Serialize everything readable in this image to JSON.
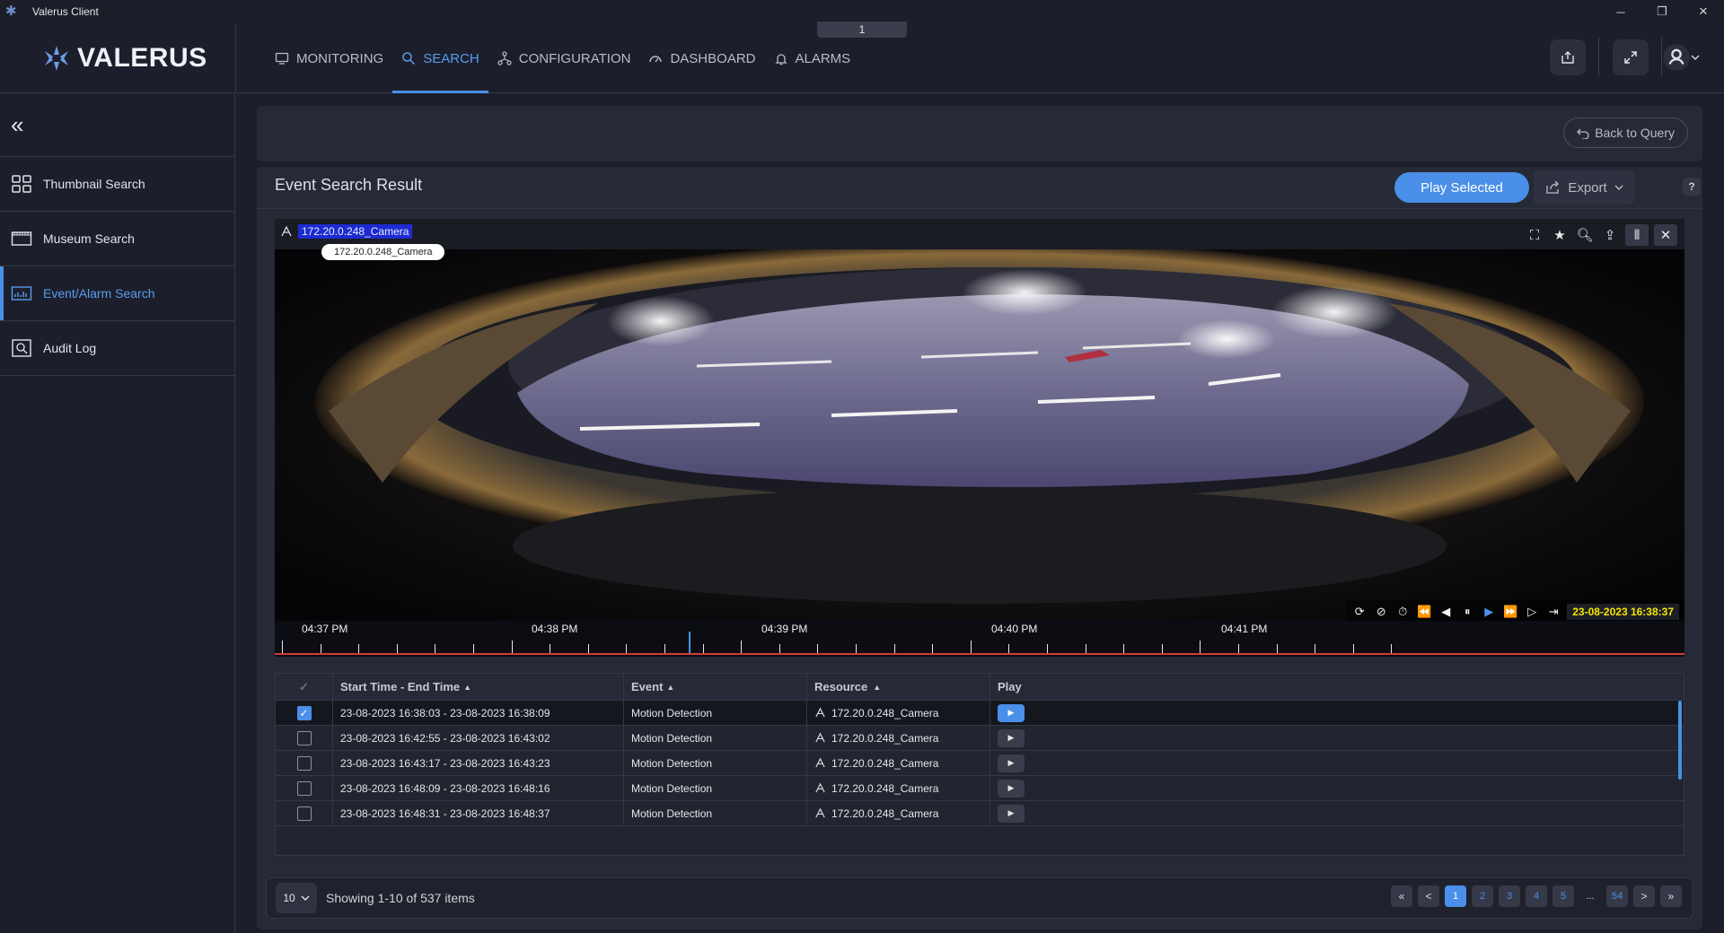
{
  "window": {
    "title": "Valerus Client",
    "page_tab": "1",
    "controls": {
      "minimize": "─",
      "restore": "❐",
      "close": "✕"
    }
  },
  "brand": {
    "name": "VALERUS"
  },
  "nav": [
    {
      "label": "MONITORING",
      "icon": "monitor-icon",
      "active": false
    },
    {
      "label": "SEARCH",
      "icon": "search-icon",
      "active": true
    },
    {
      "label": "CONFIGURATION",
      "icon": "configuration-icon",
      "active": false
    },
    {
      "label": "DASHBOARD",
      "icon": "dashboard-icon",
      "active": false
    },
    {
      "label": "ALARMS",
      "icon": "alarm-icon",
      "active": false
    }
  ],
  "sidebar": {
    "collapse_glyph": "«",
    "items": [
      {
        "label": "Thumbnail Search",
        "icon": "thumbnail-grid-icon",
        "active": false
      },
      {
        "label": "Museum Search",
        "icon": "museum-icon",
        "active": false
      },
      {
        "label": "Event/Alarm Search",
        "icon": "event-alarm-icon",
        "active": true
      },
      {
        "label": "Audit Log",
        "icon": "audit-log-icon",
        "active": false
      }
    ]
  },
  "query_bar": {
    "back_label": "Back to Query"
  },
  "result": {
    "title": "Event Search Result",
    "play_selected_label": "Play Selected",
    "help_label": "?",
    "export_label": "Export"
  },
  "video": {
    "camera_label": "172.20.0.248_Camera",
    "tooltip": "172.20.0.248_Camera",
    "timestamp": "23-08-2023 16:38:37",
    "timeline_labels": [
      "04:37 PM",
      "04:38 PM",
      "04:39 PM",
      "04:40 PM",
      "04:41 PM"
    ]
  },
  "table": {
    "headers": {
      "start_end": "Start Time - End Time",
      "event": "Event",
      "resource": "Resource",
      "play": "Play"
    },
    "rows": [
      {
        "time": "23-08-2023 16:38:03  - 23-08-2023 16:38:09",
        "event": "Motion Detection",
        "resource": "172.20.0.248_Camera",
        "checked": true
      },
      {
        "time": "23-08-2023 16:42:55  - 23-08-2023 16:43:02",
        "event": "Motion Detection",
        "resource": "172.20.0.248_Camera",
        "checked": false
      },
      {
        "time": "23-08-2023 16:43:17  - 23-08-2023 16:43:23",
        "event": "Motion Detection",
        "resource": "172.20.0.248_Camera",
        "checked": false
      },
      {
        "time": "23-08-2023 16:48:09  - 23-08-2023 16:48:16",
        "event": "Motion Detection",
        "resource": "172.20.0.248_Camera",
        "checked": false
      },
      {
        "time": "23-08-2023 16:48:31  - 23-08-2023 16:48:37",
        "event": "Motion Detection",
        "resource": "172.20.0.248_Camera",
        "checked": false
      }
    ]
  },
  "pager": {
    "page_size": "10",
    "showing": "Showing 1-10 of 537 items",
    "first": "«",
    "prev": "<",
    "next": ">",
    "last": "»",
    "pages": [
      "1",
      "2",
      "3",
      "4",
      "5"
    ],
    "ellipsis": "...",
    "last_page": "54",
    "current": "1"
  },
  "colors": {
    "accent": "#4a8fe8",
    "timestamp": "#f5e400",
    "timeline": "#d93a3a"
  }
}
